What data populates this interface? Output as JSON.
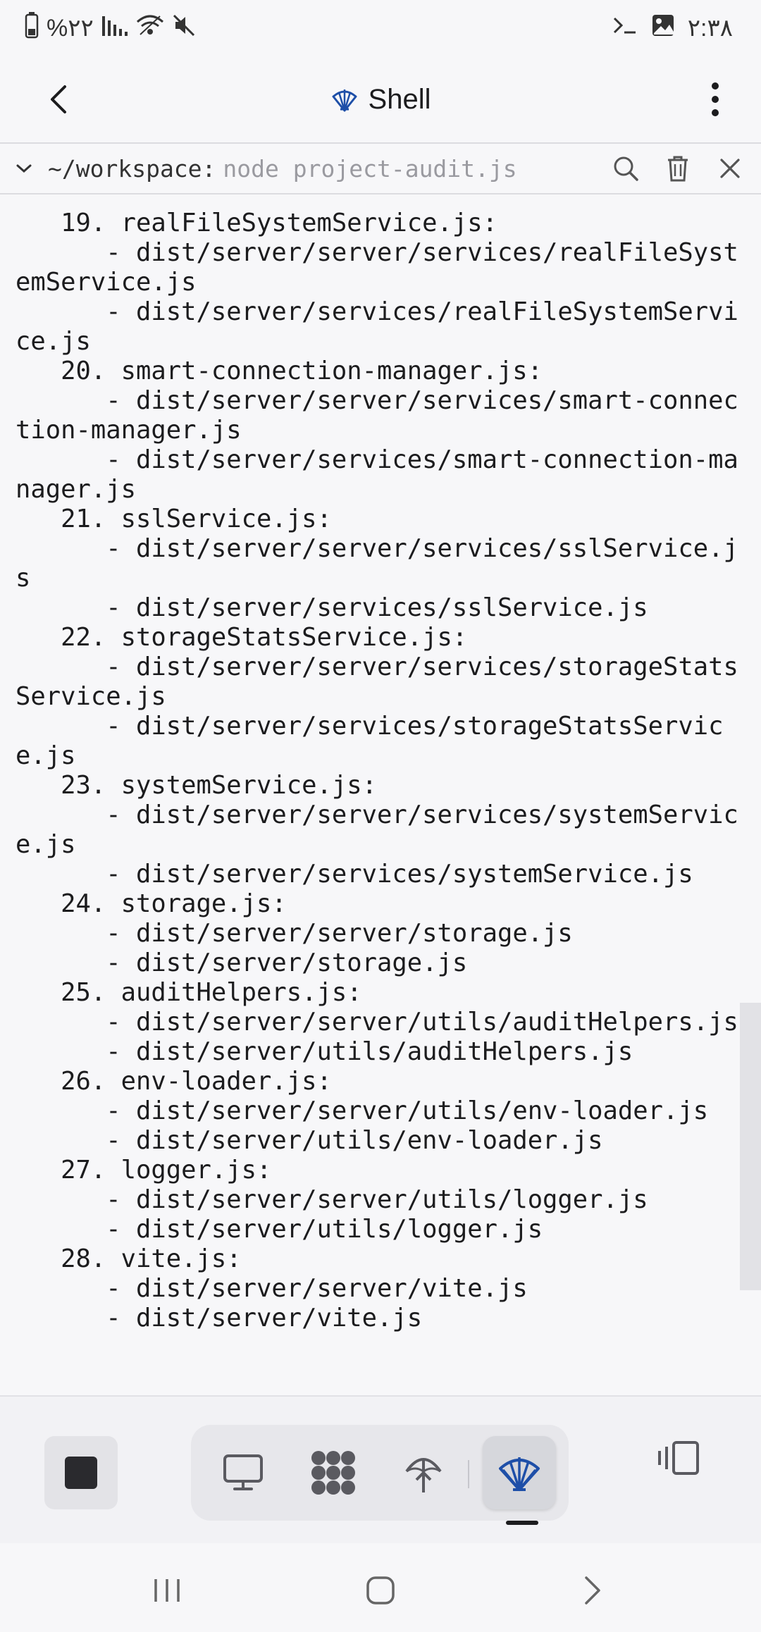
{
  "status_bar": {
    "battery": "%۲۲",
    "time": "۲:۳۸"
  },
  "app_bar": {
    "title": "Shell"
  },
  "command_bar": {
    "path": "~/workspace:",
    "command": "node project-audit.js"
  },
  "terminal": {
    "output": "   19. realFileSystemService.js:\n      - dist/server/server/services/realFileSystemService.js\n      - dist/server/services/realFileSystemService.js\n   20. smart-connection-manager.js:\n      - dist/server/server/services/smart-connection-manager.js\n      - dist/server/services/smart-connection-manager.js\n   21. sslService.js:\n      - dist/server/server/services/sslService.js\n      - dist/server/services/sslService.js\n   22. storageStatsService.js:\n      - dist/server/server/services/storageStatsService.js\n      - dist/server/services/storageStatsService.js\n   23. systemService.js:\n      - dist/server/server/services/systemService.js\n      - dist/server/services/systemService.js\n   24. storage.js:\n      - dist/server/server/storage.js\n      - dist/server/storage.js\n   25. auditHelpers.js:\n      - dist/server/server/utils/auditHelpers.js\n      - dist/server/utils/auditHelpers.js\n   26. env-loader.js:\n      - dist/server/server/utils/env-loader.js\n      - dist/server/utils/env-loader.js\n   27. logger.js:\n      - dist/server/server/utils/logger.js\n      - dist/server/utils/logger.js\n   28. vite.js:\n      - dist/server/server/vite.js\n      - dist/server/vite.js"
  },
  "bottom_dock": {
    "tabs": [
      "monitor-icon",
      "grid-icon",
      "deploy-icon",
      "shell-icon"
    ],
    "active_tab": "shell-icon"
  },
  "colors": {
    "accent": "#1e4fa8",
    "background": "#f7f7f9",
    "text": "#1c1c1e"
  }
}
